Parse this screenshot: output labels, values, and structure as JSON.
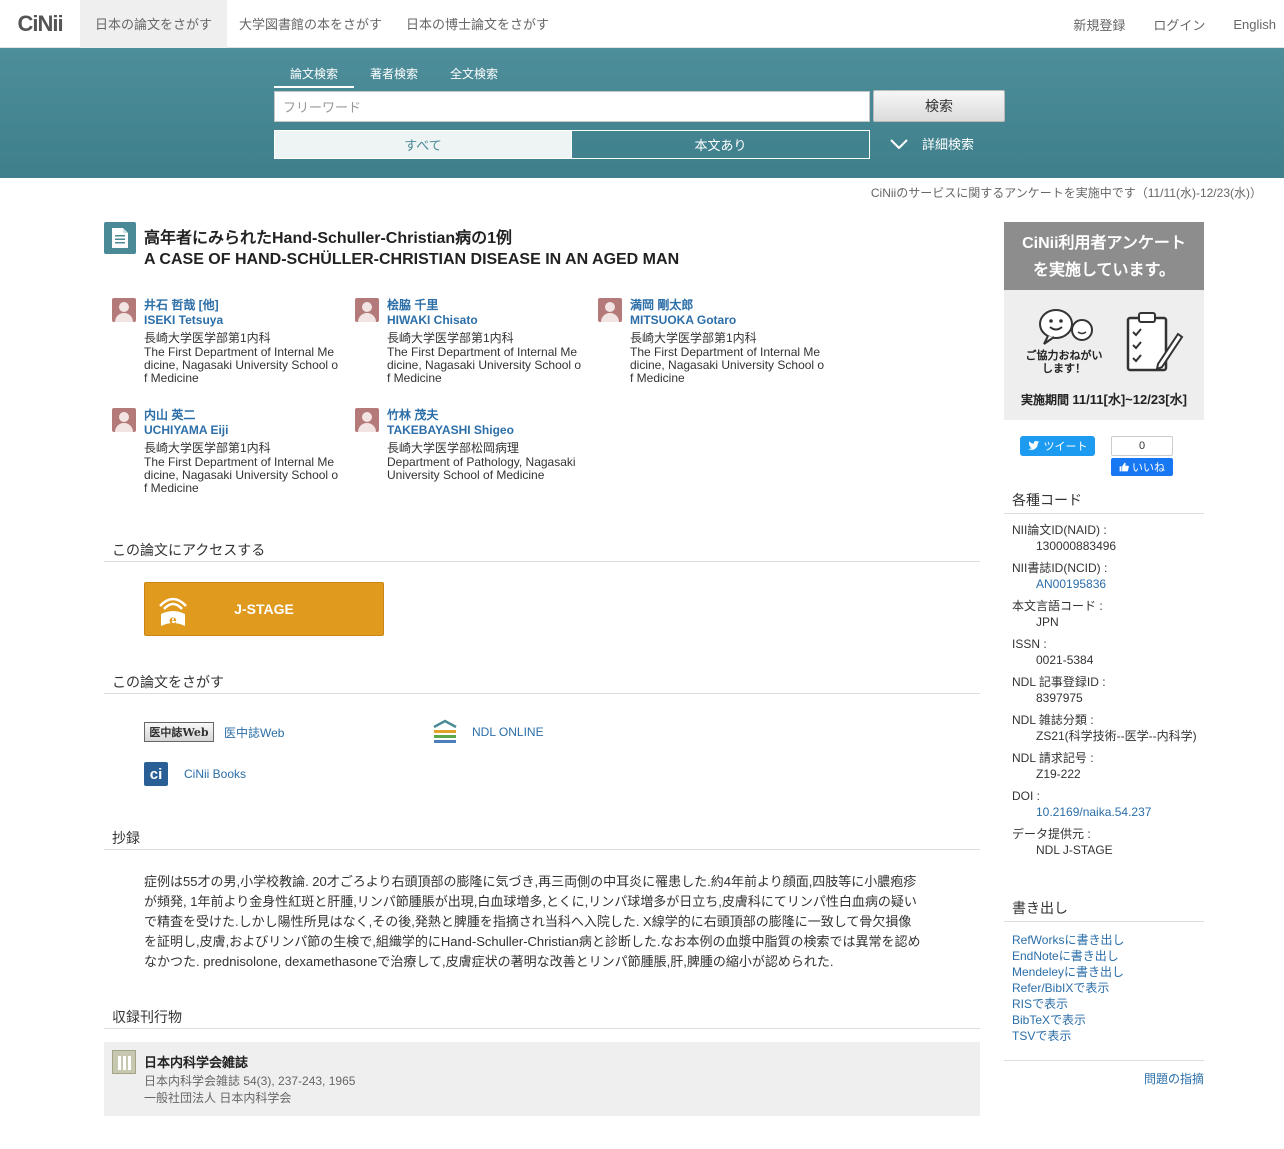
{
  "nav": {
    "logo": "CiNii",
    "tabs": [
      "日本の論文をさがす",
      "大学図書館の本をさがす",
      "日本の博士論文をさがす"
    ],
    "right": [
      "新規登録",
      "ログイン",
      "English"
    ]
  },
  "search": {
    "tabs": [
      "論文検索",
      "著者検索",
      "全文検索"
    ],
    "placeholder": "フリーワード",
    "button": "検索",
    "filters": [
      "すべて",
      "本文あり"
    ],
    "detail": "詳細検索"
  },
  "survey_notice": "CiNiiのサービスに関するアンケートを実施中です（11/11(水)-12/23(水)）",
  "article": {
    "title_ja": "高年者にみられたHand-Schuller-Christian病の1例",
    "title_en": "A CASE OF HAND-SCHÜLLER-CHRISTIAN DISEASE IN AN AGED MAN",
    "authors": [
      {
        "name": "井石 哲哉 [他]",
        "name_en": "ISEKI Tetsuya",
        "aff": "長崎大学医学部第1内科",
        "aff_en": "The First Department of Internal Medicine, Nagasaki University School of Medicine"
      },
      {
        "name": "桧脇 千里",
        "name_en": "HIWAKI Chisato",
        "aff": "長崎大学医学部第1内科",
        "aff_en": "The First Department of Internal Medicine, Nagasaki University School of Medicine"
      },
      {
        "name": "満岡 剛太郎",
        "name_en": "MITSUOKA Gotaro",
        "aff": "長崎大学医学部第1内科",
        "aff_en": "The First Department of Internal Medicine, Nagasaki University School of Medicine"
      },
      {
        "name": "内山 英二",
        "name_en": "UCHIYAMA Eiji",
        "aff": "長崎大学医学部第1内科",
        "aff_en": "The First Department of Internal Medicine, Nagasaki University School of Medicine"
      },
      {
        "name": "竹林 茂夫",
        "name_en": "TAKEBAYASHI Shigeo",
        "aff": "長崎大学医学部松岡病理",
        "aff_en": "Department of Pathology, Nagasaki University School of Medicine"
      }
    ]
  },
  "access": {
    "heading": "この論文にアクセスする",
    "jstage": "J-STAGE"
  },
  "find": {
    "heading": "この論文をさがす",
    "ichushi_logo": "医中誌Web",
    "ichushi_link": "医中誌Web",
    "ndl": "NDL ONLINE",
    "cinii_books": "CiNii Books"
  },
  "abstract": {
    "heading": "抄録",
    "text": "症例は55才の男,小学校教論. 20才ごろより右頭頂部の膨隆に気づき,再三両側の中耳炎に罹患した.約4年前より顔面,四肢等に小膿疱疹が頻発, 1年前より金身性紅斑と肝腫,リンパ節腫脹が出現,白血球増多,とくに,リンパ球増多が日立ち,皮膚科にてリンパ性白血病の疑いで精査を受けた.しかし陽性所見はなく,その後,発熱と脾腫を指摘され当科へ入院した. X線学的に右頭頂部の膨隆に一致して骨欠損像を証明し,皮膚,およびリンパ節の生検で,組織学的にHand-Schuller-Christian病と診断した.なお本例の血漿中脂質の検索では異常を認めなかつた. prednisolone, dexamethasoneで治療して,皮膚症状の著明な改善とリンパ節腫脹,肝,脾腫の縮小が認められた."
  },
  "journal": {
    "heading": "収録刊行物",
    "title": "日本内科学会雑誌",
    "citation": "日本内科学会雑誌 54(3), 237-243, 1965",
    "publisher": "一般社団法人 日本内科学会"
  },
  "sidebar": {
    "banner_title_1": "CiNii利用者アンケート",
    "banner_title_2": "を実施しています。",
    "banner_plea": "ご協力おねがいします！",
    "banner_period_label": "実施期間",
    "banner_period": "11/11[水]~12/23[水]",
    "tweet": "ツイート",
    "fb_count": "0",
    "fb_like": "いいね",
    "codes_heading": "各種コード",
    "codes": [
      {
        "k": "NII論文ID(NAID) :",
        "v": "130000883496",
        "link": false
      },
      {
        "k": "NII書誌ID(NCID) :",
        "v": "AN00195836",
        "link": true
      },
      {
        "k": "本文言語コード :",
        "v": "JPN",
        "link": false
      },
      {
        "k": "ISSN :",
        "v": "0021-5384",
        "link": false
      },
      {
        "k": "NDL 記事登録ID :",
        "v": "8397975",
        "link": false
      },
      {
        "k": "NDL 雑誌分類 :",
        "v": "ZS21(科学技術--医学--内科学)",
        "link": false
      },
      {
        "k": "NDL 請求記号 :",
        "v": "Z19-222",
        "link": false
      },
      {
        "k": "DOI :",
        "v": "10.2169/naika.54.237",
        "link": true
      },
      {
        "k": "データ提供元 :",
        "v": "NDL  J-STAGE",
        "link": false
      }
    ],
    "export_heading": "書き出し",
    "exports": [
      "RefWorksに書き出し",
      "EndNoteに書き出し",
      "Mendeleyに書き出し",
      "Refer/BibIXで表示",
      "RISで表示",
      "BibTeXで表示",
      "TSVで表示"
    ],
    "report": "問題の指摘"
  }
}
